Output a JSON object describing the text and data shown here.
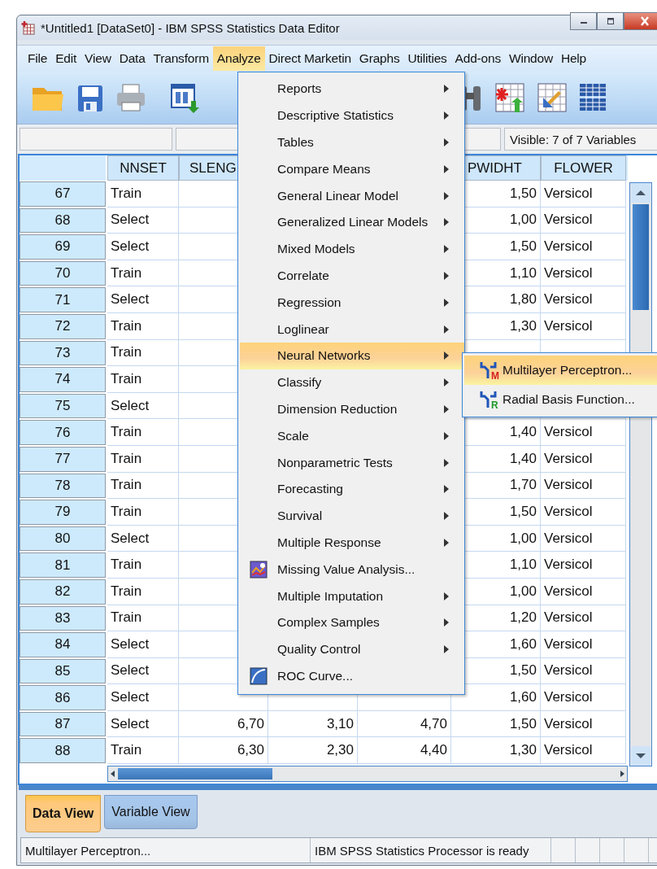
{
  "window": {
    "title": "*Untitled1 [DataSet0] - IBM SPSS Statistics Data Editor"
  },
  "menu_bar": [
    {
      "label": "File",
      "selected": false
    },
    {
      "label": "Edit",
      "selected": false
    },
    {
      "label": "View",
      "selected": false
    },
    {
      "label": "Data",
      "selected": false
    },
    {
      "label": "Transform",
      "selected": false
    },
    {
      "label": "Analyze",
      "selected": true
    },
    {
      "label": "Direct Marketin",
      "selected": false
    },
    {
      "label": "Graphs",
      "selected": false
    },
    {
      "label": "Utilities",
      "selected": false
    },
    {
      "label": "Add-ons",
      "selected": false
    },
    {
      "label": "Window",
      "selected": false
    },
    {
      "label": "Help",
      "selected": false
    }
  ],
  "variables_info": "Visible: 7 of 7 Variables",
  "table": {
    "columns": [
      "NNSET",
      "SLENG",
      null,
      null,
      "PWIDHT",
      "FLOWER"
    ],
    "rows": [
      {
        "row": "67",
        "cells": [
          "Train",
          null,
          null,
          null,
          "1,50",
          "Versicol"
        ]
      },
      {
        "row": "68",
        "cells": [
          "Select",
          null,
          null,
          null,
          "1,00",
          "Versicol"
        ]
      },
      {
        "row": "69",
        "cells": [
          "Select",
          null,
          null,
          null,
          "1,50",
          "Versicol"
        ]
      },
      {
        "row": "70",
        "cells": [
          "Train",
          null,
          null,
          null,
          "1,10",
          "Versicol"
        ]
      },
      {
        "row": "71",
        "cells": [
          "Select",
          null,
          null,
          null,
          "1,80",
          "Versicol"
        ]
      },
      {
        "row": "72",
        "cells": [
          "Train",
          null,
          null,
          null,
          "1,30",
          "Versicol"
        ]
      },
      {
        "row": "73",
        "cells": [
          "Train",
          null,
          null,
          null,
          null,
          null
        ]
      },
      {
        "row": "74",
        "cells": [
          "Train",
          null,
          null,
          null,
          null,
          null
        ]
      },
      {
        "row": "75",
        "cells": [
          "Select",
          null,
          null,
          null,
          null,
          null
        ]
      },
      {
        "row": "76",
        "cells": [
          "Train",
          null,
          null,
          null,
          "1,40",
          "Versicol"
        ]
      },
      {
        "row": "77",
        "cells": [
          "Train",
          null,
          null,
          null,
          "1,40",
          "Versicol"
        ]
      },
      {
        "row": "78",
        "cells": [
          "Train",
          null,
          null,
          null,
          "1,70",
          "Versicol"
        ]
      },
      {
        "row": "79",
        "cells": [
          "Train",
          null,
          null,
          null,
          "1,50",
          "Versicol"
        ]
      },
      {
        "row": "80",
        "cells": [
          "Select",
          null,
          null,
          null,
          "1,00",
          "Versicol"
        ]
      },
      {
        "row": "81",
        "cells": [
          "Train",
          null,
          null,
          null,
          "1,10",
          "Versicol"
        ]
      },
      {
        "row": "82",
        "cells": [
          "Train",
          null,
          null,
          null,
          "1,00",
          "Versicol"
        ]
      },
      {
        "row": "83",
        "cells": [
          "Train",
          null,
          null,
          null,
          "1,20",
          "Versicol"
        ]
      },
      {
        "row": "84",
        "cells": [
          "Select",
          null,
          null,
          null,
          "1,60",
          "Versicol"
        ]
      },
      {
        "row": "85",
        "cells": [
          "Select",
          null,
          null,
          null,
          "1,50",
          "Versicol"
        ]
      },
      {
        "row": "86",
        "cells": [
          "Select",
          null,
          null,
          null,
          "1,60",
          "Versicol"
        ]
      },
      {
        "row": "87",
        "cells": [
          "Select",
          "6,70",
          "3,10",
          "4,70",
          "1,50",
          "Versicol"
        ]
      },
      {
        "row": "88",
        "cells": [
          "Train",
          "6,30",
          "2,30",
          "4,40",
          "1,30",
          "Versicol"
        ]
      }
    ]
  },
  "analyze_menu": [
    {
      "label": "Reports",
      "kind": "submenu",
      "selected": false
    },
    {
      "label": "Descriptive Statistics",
      "kind": "submenu",
      "selected": false
    },
    {
      "label": "Tables",
      "kind": "submenu",
      "selected": false
    },
    {
      "label": "Compare Means",
      "kind": "submenu",
      "selected": false
    },
    {
      "label": "General Linear Model",
      "kind": "submenu",
      "selected": false
    },
    {
      "label": "Generalized Linear Models",
      "kind": "submenu",
      "selected": false
    },
    {
      "label": "Mixed Models",
      "kind": "submenu",
      "selected": false
    },
    {
      "label": "Correlate",
      "kind": "submenu",
      "selected": false
    },
    {
      "label": "Regression",
      "kind": "submenu",
      "selected": false
    },
    {
      "label": "Loglinear",
      "kind": "submenu",
      "selected": false
    },
    {
      "label": "Neural Networks",
      "kind": "submenu",
      "selected": true
    },
    {
      "label": "Classify",
      "kind": "submenu",
      "selected": false
    },
    {
      "label": "Dimension Reduction",
      "kind": "submenu",
      "selected": false
    },
    {
      "label": "Scale",
      "kind": "submenu",
      "selected": false
    },
    {
      "label": "Nonparametric Tests",
      "kind": "submenu",
      "selected": false
    },
    {
      "label": "Forecasting",
      "kind": "submenu",
      "selected": false
    },
    {
      "label": "Survival",
      "kind": "submenu",
      "selected": false
    },
    {
      "label": "Multiple Response",
      "kind": "submenu",
      "selected": false
    },
    {
      "label": "Missing Value Analysis...",
      "kind": "missingvalues",
      "selected": false
    },
    {
      "label": "Multiple Imputation",
      "kind": "submenu",
      "selected": false
    },
    {
      "label": "Complex Samples",
      "kind": "submenu",
      "selected": false
    },
    {
      "label": "Quality Control",
      "kind": "submenu",
      "selected": false
    },
    {
      "label": "ROC Curve...",
      "kind": "roccurve",
      "selected": false
    }
  ],
  "neural_networks_submenu": [
    {
      "label": "Multilayer Perceptron...",
      "icon_letter": "M",
      "color": "#d42020",
      "selected": true
    },
    {
      "label": "Radial Basis Function...",
      "icon_letter": "R",
      "color": "#1e9a2a",
      "selected": false
    }
  ],
  "view_tabs": [
    {
      "label": "Data View",
      "selected": true
    },
    {
      "label": "Variable View",
      "selected": false
    }
  ],
  "status_bar": [
    "Multilayer Perceptron...",
    "IBM SPSS Statistics Processor is ready"
  ]
}
